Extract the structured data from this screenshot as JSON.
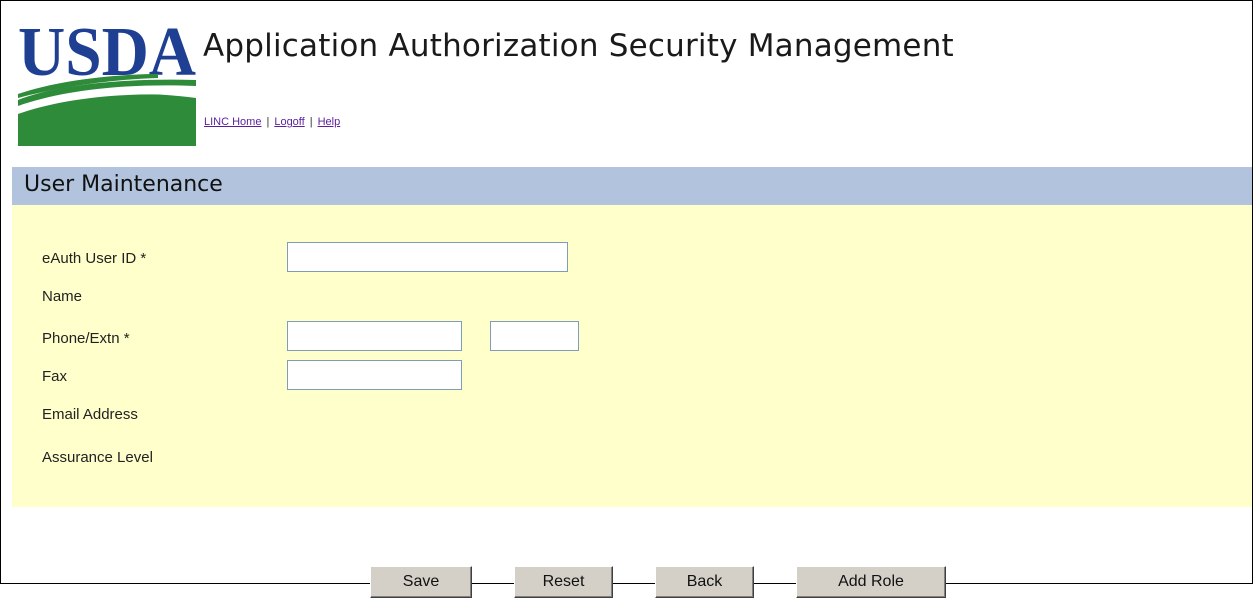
{
  "header": {
    "logo_text": "USDA",
    "app_title": "Application Authorization Security Management"
  },
  "topnav": {
    "links": [
      "LINC Home",
      "Logoff",
      "Help"
    ],
    "separator": "|"
  },
  "section": {
    "title": "User Maintenance"
  },
  "form": {
    "eauth_label": "eAuth User ID *",
    "eauth_value": "",
    "name_label": "Name",
    "phone_label": "Phone/Extn *",
    "phone_value": "",
    "extn_value": "",
    "fax_label": "Fax",
    "fax_value": "",
    "email_label": "Email Address",
    "assurance_label": "Assurance Level"
  },
  "buttons": {
    "save": "Save",
    "reset": "Reset",
    "back": "Back",
    "add_role": "Add Role"
  },
  "colors": {
    "header_band": "#b2c4dd",
    "form_background": "#ffffcc",
    "logo_blue": "#1f3f93",
    "logo_green": "#2e8b3a",
    "link_color": "#5b1f9c"
  }
}
